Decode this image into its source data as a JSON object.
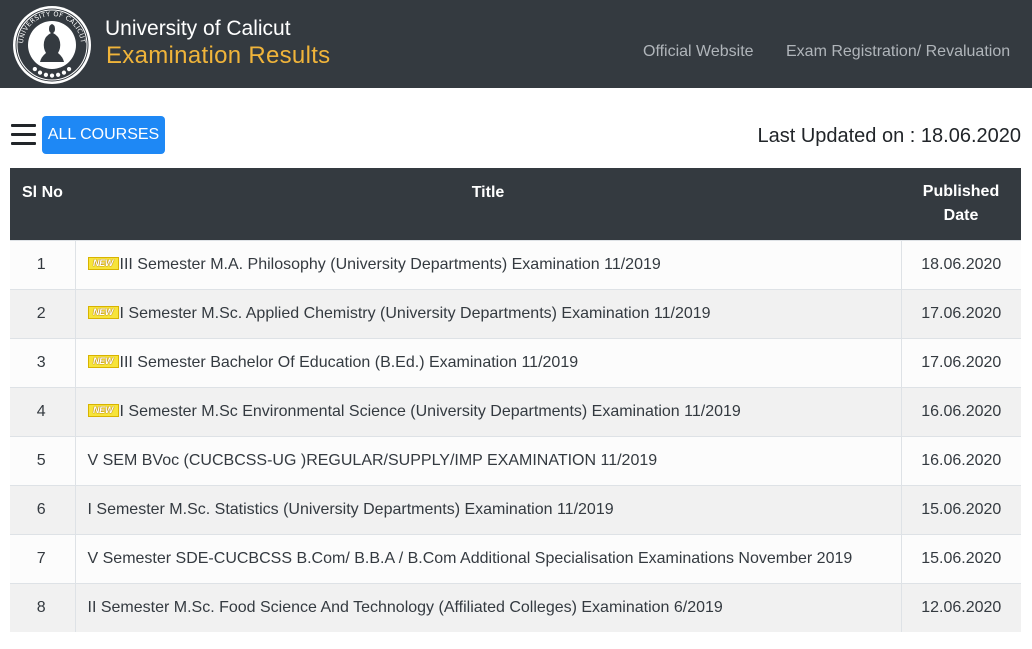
{
  "header": {
    "university": "University of Calicut",
    "subtitle": "Examination Results",
    "logo_icon": "university-seal-icon",
    "logo_text": "ஜவਅറിവില്ലാതെ",
    "nav": [
      {
        "label": "Official Website"
      },
      {
        "label": "Exam Registration/ Revaluation"
      }
    ]
  },
  "toolbar": {
    "menu_icon": "hamburger-menu-icon",
    "all_courses_label": "ALL COURSES",
    "last_updated": "Last Updated on : 18.06.2020"
  },
  "table": {
    "headers": {
      "sl_no": "Sl No",
      "title": "Title",
      "published": "Published Date"
    },
    "new_badge": "NEW",
    "rows": [
      {
        "sl": "1",
        "new": true,
        "title": "III Semester M.A. Philosophy (University Departments) Examination 11/2019",
        "date": "18.06.2020"
      },
      {
        "sl": "2",
        "new": true,
        "title": "I Semester M.Sc. Applied Chemistry (University Departments) Examination 11/2019",
        "date": "17.06.2020"
      },
      {
        "sl": "3",
        "new": true,
        "title": "III Semester Bachelor Of Education (B.Ed.) Examination 11/2019",
        "date": "17.06.2020"
      },
      {
        "sl": "4",
        "new": true,
        "title": "I Semester M.Sc Environmental Science (University Departments) Examination 11/2019",
        "date": "16.06.2020"
      },
      {
        "sl": "5",
        "new": false,
        "title": "V SEM BVoc (CUCBCSS-UG )REGULAR/SUPPLY/IMP EXAMINATION 11/2019",
        "date": "16.06.2020"
      },
      {
        "sl": "6",
        "new": false,
        "title": "I Semester M.Sc. Statistics (University Departments) Examination 11/2019",
        "date": "15.06.2020"
      },
      {
        "sl": "7",
        "new": false,
        "title": "V Semester SDE-CUCBCSS B.Com/ B.B.A / B.Com Additional Specialisation Examinations November 2019",
        "date": "15.06.2020"
      },
      {
        "sl": "8",
        "new": false,
        "title": "II Semester M.Sc. Food Science And Technology (Affiliated Colleges) Examination 6/2019",
        "date": "12.06.2020"
      }
    ]
  },
  "colors": {
    "navbar": "#343a40",
    "subtitle": "#f0b43a",
    "button": "#1e88f5",
    "nav_link": "#b0b5ba"
  }
}
